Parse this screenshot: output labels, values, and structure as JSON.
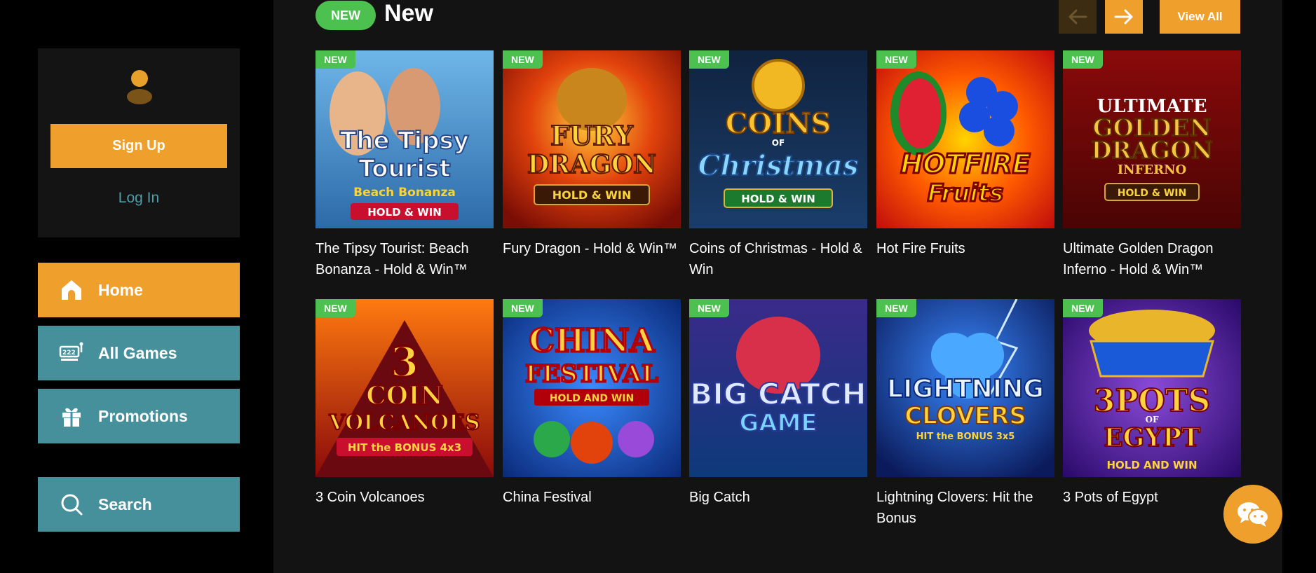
{
  "sidebar": {
    "sign_up": "Sign Up",
    "log_in": "Log In",
    "nav": [
      {
        "label": "Home",
        "icon": "home-icon"
      },
      {
        "label": "All Games",
        "icon": "slot-machine-icon"
      },
      {
        "label": "Promotions",
        "icon": "gift-icon"
      },
      {
        "label": "Search",
        "icon": "search-icon"
      }
    ]
  },
  "section": {
    "pill": "NEW",
    "title": "New",
    "view_all": "View All"
  },
  "games": [
    {
      "badge": "NEW",
      "title": "The Tipsy Tourist: Beach Bonanza - Hold & Win™",
      "art": [
        "The Tipsy",
        "Tourist",
        "Beach Bonanza",
        "HOLD & WIN"
      ]
    },
    {
      "badge": "NEW",
      "title": "Fury Dragon - Hold & Win™",
      "art": [
        "FURY",
        "DRAGON",
        "HOLD & WIN"
      ]
    },
    {
      "badge": "NEW",
      "title": "Coins of Christmas - Hold & Win",
      "art": [
        "COINS",
        "OF",
        "Christmas",
        "HOLD & WIN"
      ]
    },
    {
      "badge": "NEW",
      "title": "Hot Fire Fruits",
      "art": [
        "HOTFIRE",
        "Fruits"
      ]
    },
    {
      "badge": "NEW",
      "title": "Ultimate Golden Dragon Inferno - Hold & Win™",
      "art": [
        "ULTIMATE",
        "GOLDEN",
        "DRAGON",
        "INFERNO",
        "HOLD & WIN"
      ]
    },
    {
      "badge": "NEW",
      "title": "3 Coin Volcanoes",
      "art": [
        "3",
        "COIN",
        "VOLCANOES",
        "HIT the BONUS 4x3"
      ]
    },
    {
      "badge": "NEW",
      "title": "China Festival",
      "art": [
        "CHINA",
        "FESTIVAL",
        "HOLD AND WIN"
      ]
    },
    {
      "badge": "NEW",
      "title": "Big Catch",
      "art": [
        "BIG CATCH",
        "GAME"
      ]
    },
    {
      "badge": "NEW",
      "title": "Lightning Clovers: Hit the Bonus",
      "art": [
        "LIGHTNING",
        "CLOVERS",
        "HIT the BONUS 3x5"
      ]
    },
    {
      "badge": "NEW",
      "title": "3 Pots of Egypt",
      "art": [
        "3POTS",
        "OF",
        "EGYPT",
        "HOLD AND WIN"
      ]
    }
  ],
  "colors": {
    "accent": "#ef9f2b",
    "teal": "#46909b",
    "new_badge": "#4cc14f",
    "background": "#131313"
  },
  "icons": {
    "prev": "arrow-left-icon",
    "next": "arrow-right-icon",
    "chat": "wechat-icon",
    "avatar": "user-icon"
  }
}
